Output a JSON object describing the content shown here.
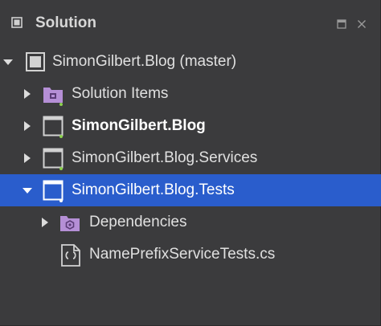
{
  "panel": {
    "title": "Solution",
    "icon": "solution-panel-icon",
    "buttons": [
      {
        "name": "dock-icon"
      },
      {
        "name": "close-icon"
      }
    ]
  },
  "tree": [
    {
      "label": "SimonGilbert.Blog (master)",
      "icon": "solution-icon",
      "expanded": true,
      "bold": false
    },
    {
      "label": "Solution Items",
      "icon": "solution-folder-icon",
      "expanded": false,
      "bold": false
    },
    {
      "label": "SimonGilbert.Blog",
      "icon": "project-icon",
      "expanded": false,
      "bold": true
    },
    {
      "label": "SimonGilbert.Blog.Services",
      "icon": "project-icon",
      "expanded": false,
      "bold": false
    },
    {
      "label": "SimonGilbert.Blog.Tests",
      "icon": "project-icon",
      "expanded": true,
      "bold": false,
      "selected": true
    },
    {
      "label": "Dependencies",
      "icon": "dependencies-folder-icon",
      "expanded": false,
      "bold": false
    },
    {
      "label": "NamePrefixServiceTests.cs",
      "icon": "csharp-file-icon",
      "bold": false
    }
  ],
  "colors": {
    "background": "#3b3b3d",
    "selection": "#2a5dcc",
    "text": "#e0e0e0",
    "folder": "#b58fd6",
    "status_dot": "#8bd14d"
  }
}
